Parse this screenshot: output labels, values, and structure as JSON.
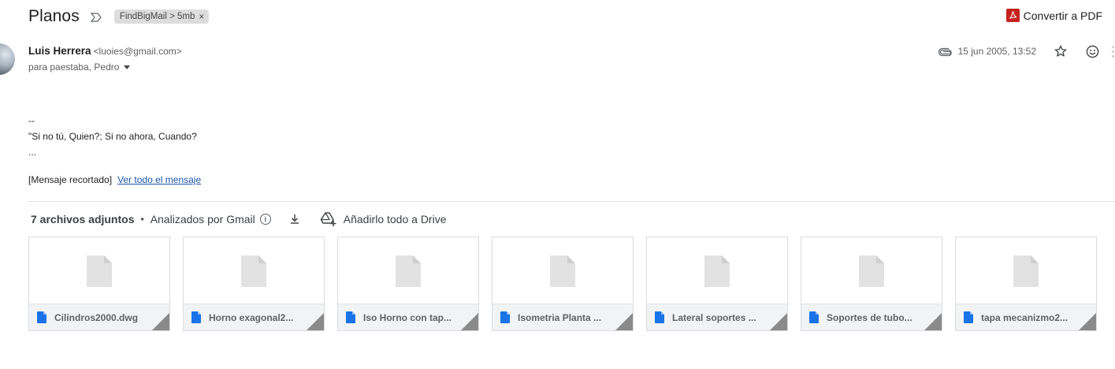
{
  "subject": "Planos",
  "label": "FindBigMail > 5mb",
  "label_remove": "×",
  "convert_pdf": "Convertir a PDF",
  "sender": {
    "name": "Luis Herrera",
    "email": "<luoies@gmail.com>",
    "recipients": "para paestaba, Pedro"
  },
  "date": "15 jun 2005, 13:52",
  "body_lines": [
    "--",
    "\"Si no tú, Quien?; Si no ahora, Cuando?",
    "..."
  ],
  "trimmed_label": "[Mensaje recortado]",
  "view_full_link": "Ver todo el mensaje",
  "attachments_header": {
    "count": "7 archivos adjuntos",
    "separator": "•",
    "scanned": "Analizados por Gmail",
    "add_to_drive": "Añadirlo todo a Drive"
  },
  "attachments": [
    {
      "name": "Cilindros2000.dwg"
    },
    {
      "name": "Horno exagonal2..."
    },
    {
      "name": "Iso Horno con tap..."
    },
    {
      "name": "Isometria Planta ..."
    },
    {
      "name": "Lateral soportes ..."
    },
    {
      "name": "Soportes de tubo..."
    },
    {
      "name": "tapa mecanizmo2..."
    }
  ],
  "colors": {
    "link": "#1a56a8",
    "file_icon": "#1a73e8",
    "pdf_icon": "#c5221f",
    "label_chip": "#dddddd"
  }
}
